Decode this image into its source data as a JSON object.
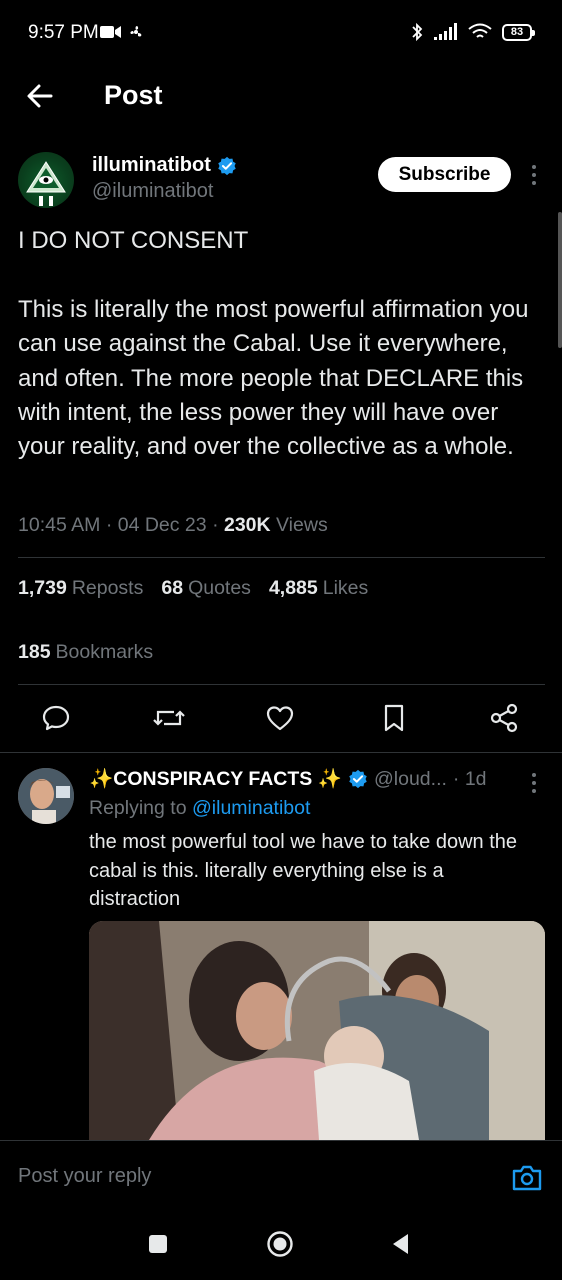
{
  "status_bar": {
    "time": "9:57 PM",
    "battery": "83"
  },
  "top_bar": {
    "title": "Post"
  },
  "post": {
    "author_name": "illuminatibot",
    "author_handle": "@iluminatibot",
    "subscribe_label": "Subscribe",
    "text": "I DO NOT CONSENT\n\nThis is literally the most powerful affirmation you can use against the Cabal. Use it everywhere, and often. The more people that DECLARE this with intent, the less power they will have over your reality, and over the collective as a whole.",
    "time": "10:45 AM",
    "date": "04 Dec 23",
    "views_count": "230K",
    "views_label": "Views",
    "reposts_count": "1,739",
    "reposts_label": "Reposts",
    "quotes_count": "68",
    "quotes_label": "Quotes",
    "likes_count": "4,885",
    "likes_label": "Likes",
    "bookmarks_count": "185",
    "bookmarks_label": "Bookmarks"
  },
  "reply": {
    "author_name": "✨CONSPIRACY FACTS ✨",
    "author_handle": "@loud...",
    "age": "· 1d",
    "replying_prefix": "Replying to",
    "replying_to": "@iluminatibot",
    "text": "the most powerful tool we have to take down the cabal is this. literally everything else is a distraction"
  },
  "composer": {
    "placeholder": "Post your reply"
  },
  "icons": {
    "back": "arrow-left-icon",
    "verified": "verified-badge-icon",
    "reply": "comment-icon",
    "repost": "repost-icon",
    "like": "heart-icon",
    "bookmark": "bookmark-icon",
    "share": "share-icon",
    "camera": "camera-icon"
  },
  "colors": {
    "accent": "#1d9bf0",
    "background": "#000000",
    "muted": "#71767b"
  }
}
